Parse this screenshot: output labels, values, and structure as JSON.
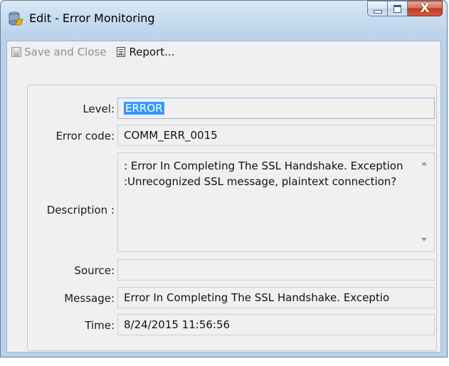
{
  "window": {
    "title": "Edit - Error Monitoring",
    "close_glyph": "X"
  },
  "toolbar": {
    "save_label": "Save and Close",
    "report_label": "Report..."
  },
  "form": {
    "level": {
      "label": "Level:",
      "value": "ERROR"
    },
    "error_code": {
      "label": "Error code:",
      "value": "COMM_ERR_0015"
    },
    "description": {
      "label": "Description :",
      "value": " : Error In Completing The SSL Handshake. Exception :Unrecognized SSL message, plaintext connection?"
    },
    "source": {
      "label": "Source:",
      "value": ""
    },
    "message": {
      "label": "Message:",
      "value": "Error In Completing The SSL Handshake. Exceptio"
    },
    "time": {
      "label": "Time:",
      "value": "8/24/2015 11:56:56"
    }
  },
  "icons": {
    "app": "database-icon",
    "save": "floppy-disk-icon",
    "report": "report-icon"
  },
  "colors": {
    "selection": "#3399ff",
    "frame": "#b9d1ea",
    "close_button": "#c03a21"
  }
}
